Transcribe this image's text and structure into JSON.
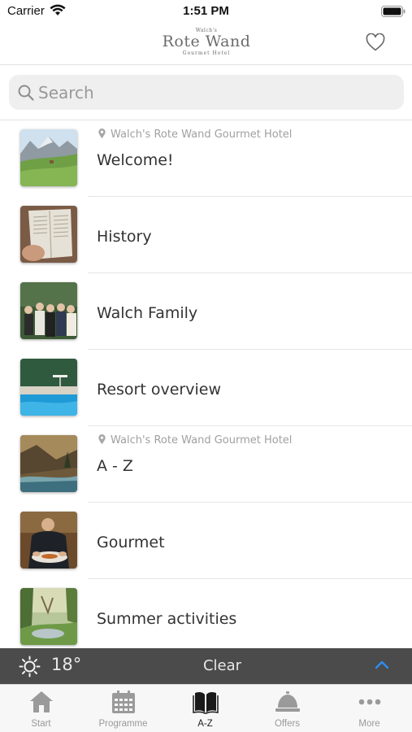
{
  "status_bar": {
    "carrier": "Carrier",
    "time": "1:51 PM"
  },
  "header": {
    "logo_small": "Walch's",
    "logo_main": "Rote Wand",
    "logo_sub": "Gourmet Hotel",
    "favorite_icon": "heart-outline-icon"
  },
  "search": {
    "placeholder": "Search",
    "icon": "search-icon"
  },
  "list": {
    "items": [
      {
        "subtitle": "Walch's Rote Wand Gourmet Hotel",
        "title": "Welcome!"
      },
      {
        "subtitle": "",
        "title": "History"
      },
      {
        "subtitle": "",
        "title": "Walch Family"
      },
      {
        "subtitle": "",
        "title": "Resort overview"
      },
      {
        "subtitle": "Walch's Rote Wand Gourmet Hotel",
        "title": "A - Z"
      },
      {
        "subtitle": "",
        "title": "Gourmet"
      },
      {
        "subtitle": "",
        "title": "Summer activities"
      }
    ]
  },
  "weather": {
    "icon": "sun-icon",
    "temperature": "18°",
    "condition": "Clear",
    "expand_icon": "chevron-up-icon",
    "accent": "#2f8cf0"
  },
  "tabbar": {
    "active_index": 2,
    "tabs": [
      {
        "label": "Start",
        "icon": "home-icon"
      },
      {
        "label": "Programme",
        "icon": "calendar-icon"
      },
      {
        "label": "A-Z",
        "icon": "book-icon"
      },
      {
        "label": "Offers",
        "icon": "service-bell-icon"
      },
      {
        "label": "More",
        "icon": "more-dots-icon"
      }
    ]
  }
}
